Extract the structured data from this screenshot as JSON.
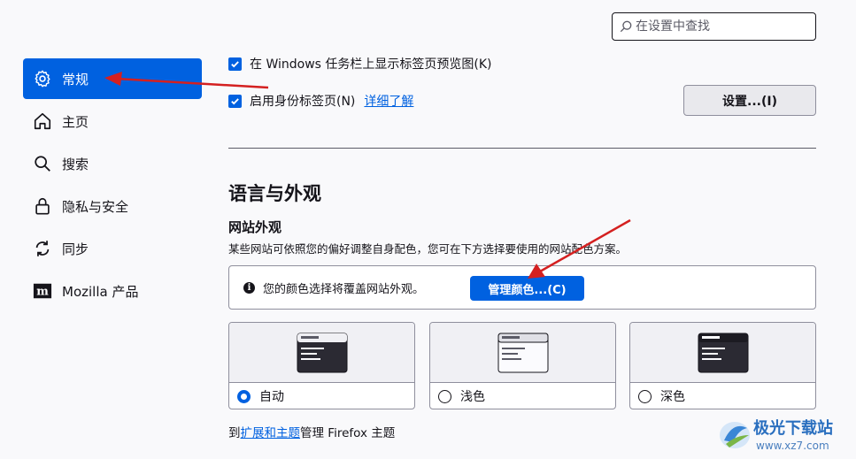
{
  "search": {
    "placeholder": "在设置中查找"
  },
  "sidebar": {
    "items": [
      {
        "label": "常规",
        "icon": "gear-icon",
        "active": true
      },
      {
        "label": "主页",
        "icon": "home-icon"
      },
      {
        "label": "搜索",
        "icon": "search-icon"
      },
      {
        "label": "隐私与安全",
        "icon": "lock-icon"
      },
      {
        "label": "同步",
        "icon": "sync-icon"
      },
      {
        "label": "Mozilla 产品",
        "icon": "mozilla-icon"
      }
    ]
  },
  "general": {
    "taskbar_preview_label": "在 Windows 任务栏上显示标签页预览图(K)",
    "containers_label": "启用身份标签页(N)",
    "containers_learn_more": "详细了解",
    "settings_button": "设置...(I)"
  },
  "language_appearance": {
    "heading": "语言与外观",
    "website_appearance_heading": "网站外观",
    "description": "某些网站可依照您的偏好调整自身配色，您可在下方选择要使用的网站配色方案。",
    "info_text": "您的颜色选择将覆盖网站外观。",
    "manage_colors_button": "管理颜色...(C)",
    "themes": [
      {
        "label": "自动",
        "selected": true
      },
      {
        "label": "浅色",
        "selected": false
      },
      {
        "label": "深色",
        "selected": false
      }
    ],
    "footer_prefix": "到",
    "footer_link": "扩展和主题",
    "footer_suffix": "管理 Firefox 主题"
  },
  "watermark": {
    "brand": "极光下载站",
    "url": "www.xz7.com"
  },
  "colors": {
    "accent": "#0061e0",
    "annotation": "#d42020",
    "background": "#f9f9fb"
  }
}
